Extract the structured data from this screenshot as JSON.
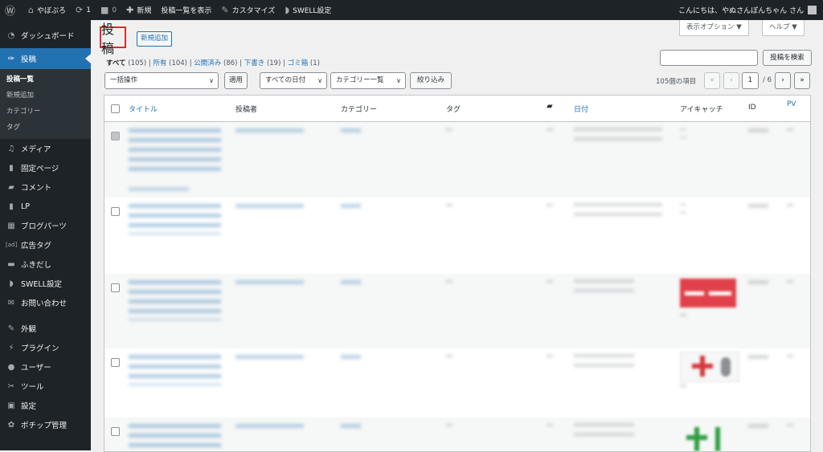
{
  "adminbar": {
    "site_name": "やぼぷろ",
    "updates_count": "1",
    "comments_count": "0",
    "new_label": "新規",
    "view_posts_label": "投稿一覧を表示",
    "customize_label": "カスタマイズ",
    "swell_label": "SWELL設定",
    "greeting": "こんにちは、やぬさんぽんちゃん さん"
  },
  "sidebar": {
    "items": [
      {
        "label": "ダッシュボード",
        "icon": "dashboard-icon"
      },
      {
        "label": "投稿",
        "icon": "pin-icon"
      },
      {
        "label": "メディア",
        "icon": "media-icon"
      },
      {
        "label": "固定ページ",
        "icon": "page-icon"
      },
      {
        "label": "コメント",
        "icon": "comment-icon"
      },
      {
        "label": "LP",
        "icon": "lp-icon"
      },
      {
        "label": "ブログパーツ",
        "icon": "blocks-icon"
      },
      {
        "label": "広告タグ",
        "icon": "ad-icon"
      },
      {
        "label": "ふきだし",
        "icon": "balloon-icon"
      },
      {
        "label": "SWELL設定",
        "icon": "swell-icon"
      },
      {
        "label": "お問い合わせ",
        "icon": "mail-icon"
      },
      {
        "label": "外観",
        "icon": "brush-icon"
      },
      {
        "label": "プラグイン",
        "icon": "plugin-icon"
      },
      {
        "label": "ユーザー",
        "icon": "user-icon"
      },
      {
        "label": "ツール",
        "icon": "wrench-icon"
      },
      {
        "label": "設定",
        "icon": "settings-icon"
      },
      {
        "label": "ポチップ管理",
        "icon": "paw-icon"
      }
    ],
    "submenu": [
      "投稿一覧",
      "新規追加",
      "カテゴリー",
      "タグ"
    ]
  },
  "page": {
    "title": "投稿",
    "add_new": "新規追加",
    "screen_options": "表示オプション ▼",
    "help": "ヘルプ ▼"
  },
  "filters": {
    "all": "すべて",
    "all_count": "(105)",
    "mine": "所有",
    "mine_count": "(104)",
    "published": "公開済み",
    "published_count": "(86)",
    "draft": "下書き",
    "draft_count": "(19)",
    "trash": "ゴミ箱",
    "trash_count": "(1)"
  },
  "search": {
    "button": "投稿を検索",
    "value": ""
  },
  "toolbar": {
    "bulk_action": "一括操作",
    "apply": "適用",
    "all_dates": "すべての日付",
    "category_filter": "カテゴリー一覧",
    "filter_button": "絞り込み",
    "items_count": "105個の項目",
    "first_page": "«",
    "prev_page": "‹",
    "current_page": "1",
    "total_pages": "/ 6",
    "next_page": "›",
    "last_page": "»"
  },
  "table": {
    "columns": {
      "title": "タイトル",
      "author": "投稿者",
      "categories": "カテゴリー",
      "tags": "タグ",
      "date": "日付",
      "eyecatch": "アイキャッチ",
      "id": "ID",
      "pv": "PV"
    }
  },
  "colors": {
    "adminbar": "#1d2327",
    "accent": "#2271b1",
    "highlight_box": "#e12a2a"
  }
}
